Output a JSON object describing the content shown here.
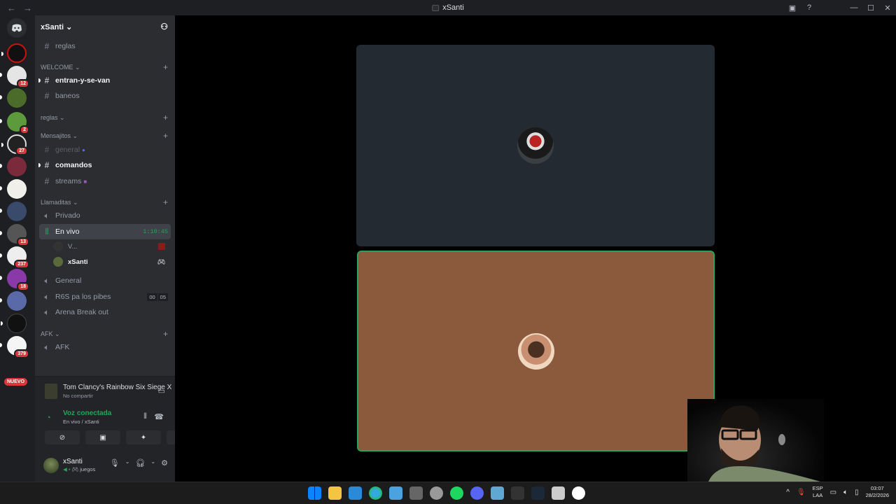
{
  "window": {
    "title": "xSanti",
    "nav_back": "←",
    "nav_forward": "→"
  },
  "server": {
    "name": "xSanti"
  },
  "colors": {
    "accent_green": "#23a55a",
    "badge_red": "#da373c",
    "tile_dark": "#232a31",
    "tile_brown": "#8b5a3c"
  },
  "servers": [
    {
      "badge": ""
    },
    {
      "badge": "12"
    },
    {
      "badge": ""
    },
    {
      "badge": "2"
    },
    {
      "badge": "27"
    },
    {
      "badge": ""
    },
    {
      "badge": ""
    },
    {
      "badge": ""
    },
    {
      "badge": "13"
    },
    {
      "badge": "237"
    },
    {
      "badge": "18"
    },
    {
      "badge": ""
    },
    {
      "badge": ""
    },
    {
      "badge": "379"
    }
  ],
  "new_badge": "NUEVO",
  "channels": {
    "reglas_top": "reglas",
    "cat_welcome": "WELCOME",
    "entran": "entran-y-se-van",
    "baneos": "baneos",
    "cat_reglas": "reglas",
    "cat_mensajitos": "Mensajitos",
    "general": "general",
    "comandos": "comandos",
    "streams": "streams",
    "cat_llamaditas": "Llamaditas",
    "privado": "Privado",
    "en_vivo": "En vivo",
    "en_vivo_timer": "1:10:45",
    "voice_user_1": "V...",
    "voice_user_2": "xSanti",
    "general_voice": "General",
    "r6s": "R6S pa los pibes",
    "r6s_count_1": "00",
    "r6s_count_2": "05",
    "arena": "Arena Break out",
    "cat_afk": "AFK",
    "afk": "AFK"
  },
  "activity": {
    "game": "Tom Clancy's Rainbow Six Siege X",
    "status": "No compartir"
  },
  "voice": {
    "title": "Voz conectada",
    "subtitle": "En vivo / xSanti"
  },
  "user": {
    "name": "xSanti",
    "status": "juegos"
  },
  "taskbar": {
    "lang_1": "ESP",
    "lang_2": "LAA",
    "time": "03:07",
    "date": "28/2/2026"
  }
}
